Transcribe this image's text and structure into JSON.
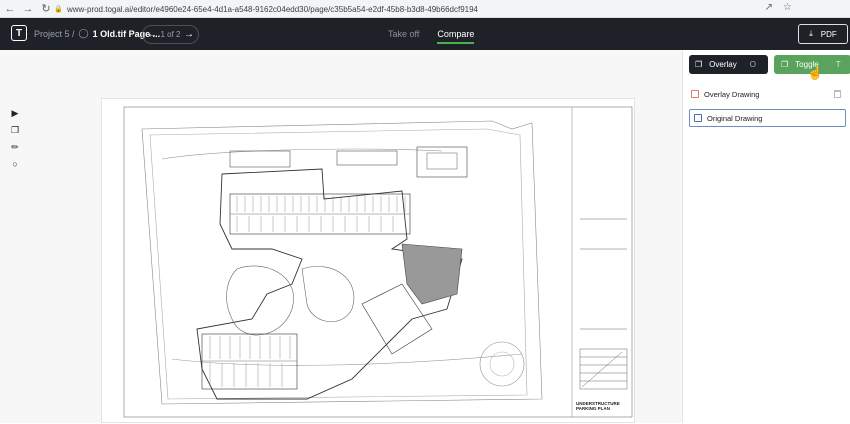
{
  "browser": {
    "url": "www-prod.togal.ai/editor/e4960e24-65e4-4d1a-a548-9162c04edd30/page/c35b5a54-e2df-45b8-b3d8-49b66dcf9194",
    "back_icon": "arrow-left-icon",
    "forward_icon": "arrow-right-icon",
    "reload_icon": "reload-icon"
  },
  "header": {
    "logo": "T",
    "project": "Project 5 /",
    "file": "1 Old.tif Page ...",
    "page_indicator": "1 of 2",
    "tabs": [
      "Take off",
      "Compare"
    ],
    "active_tab": "Compare",
    "pdf_label": "PDF"
  },
  "panel": {
    "overlay_label": "Overlay",
    "overlay_key": "O",
    "toggle_label": "Toggle",
    "toggle_key": "T",
    "layers": [
      {
        "label": "Overlay Drawing"
      },
      {
        "label": "Original Drawing"
      }
    ]
  },
  "drawing": {
    "labels": [
      "UNDERSTRUCTURE PARKING PLAN"
    ]
  },
  "colors": {
    "appbar": "#1e2228",
    "accent_green": "#5aa35d",
    "overlay_icon": "#e27b5b"
  }
}
